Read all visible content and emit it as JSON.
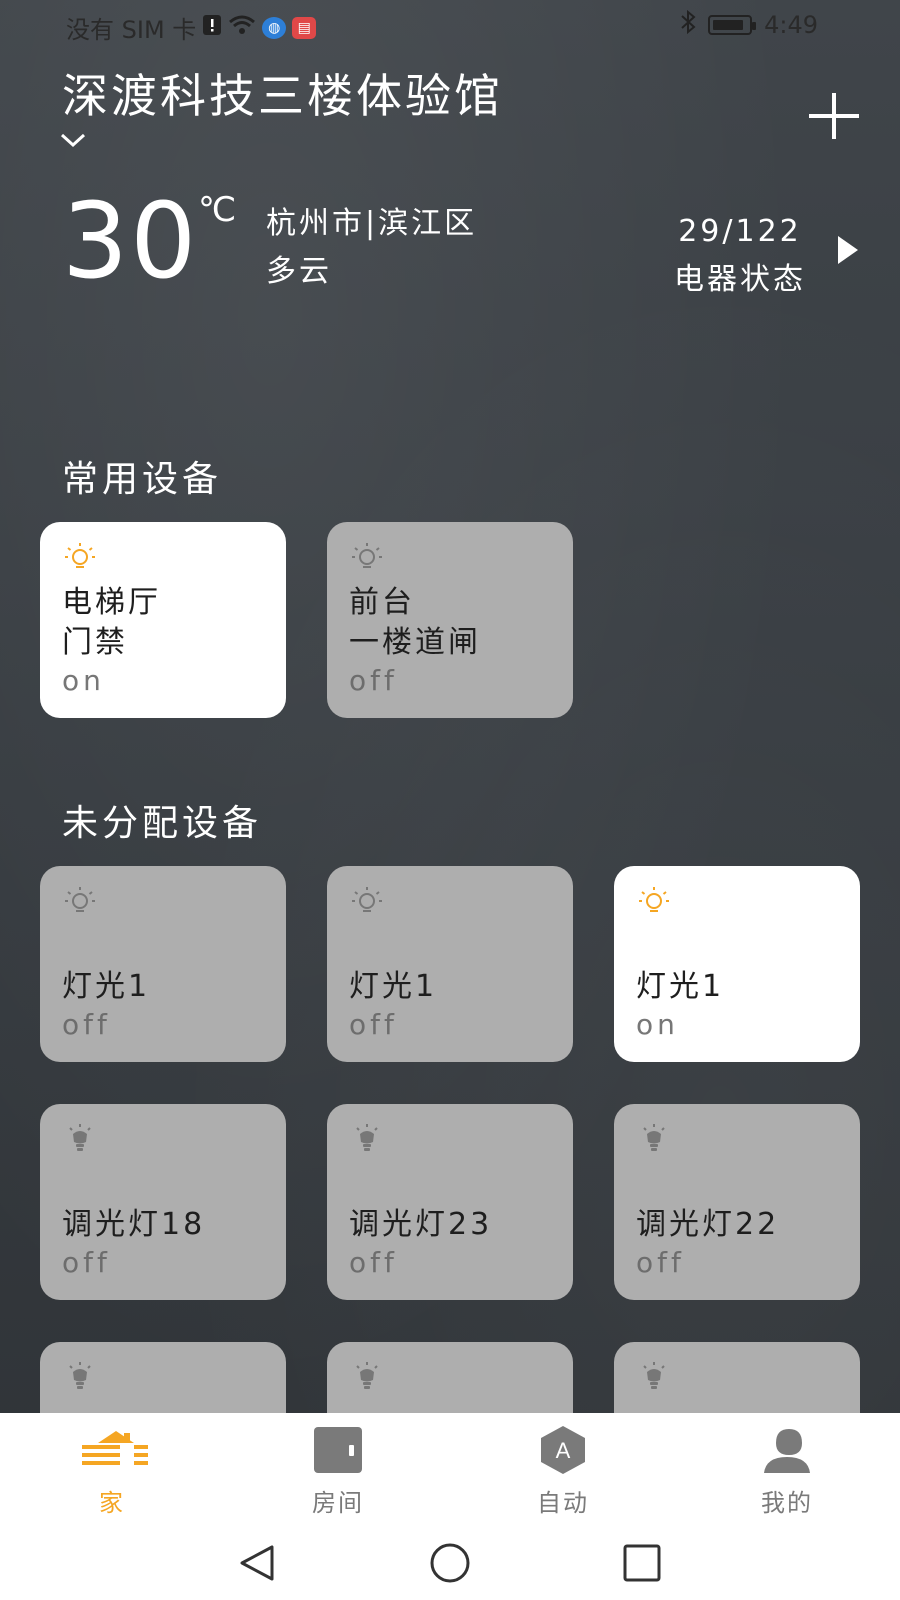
{
  "status_bar": {
    "carrier": "没有 SIM 卡",
    "time": "4:49"
  },
  "header": {
    "home_name": "深渡科技三楼体验馆"
  },
  "weather": {
    "temperature": "30",
    "unit": "℃",
    "location": "杭州市|滨江区",
    "condition": "多云"
  },
  "device_summary": {
    "count": "29/122",
    "label": "电器状态"
  },
  "favorites": {
    "title": "常用设备",
    "cards": [
      {
        "name1": "电梯厅",
        "name2": "门禁",
        "state": "on"
      },
      {
        "name1": "前台",
        "name2": "一楼道闸",
        "state": "off"
      }
    ]
  },
  "unassigned": {
    "title": "未分配设备",
    "cards": [
      {
        "name": "灯光1",
        "state": "off"
      },
      {
        "name": "灯光1",
        "state": "off"
      },
      {
        "name": "灯光1",
        "state": "on"
      },
      {
        "name": "调光灯18",
        "state": "off"
      },
      {
        "name": "调光灯23",
        "state": "off"
      },
      {
        "name": "调光灯22",
        "state": "off"
      }
    ]
  },
  "bottom_nav": {
    "items": [
      {
        "label": "家",
        "icon": "home-icon",
        "active": true
      },
      {
        "label": "房间",
        "icon": "door-icon",
        "active": false
      },
      {
        "label": "自动",
        "icon": "automation-icon",
        "active": false
      },
      {
        "label": "我的",
        "icon": "profile-icon",
        "active": false
      }
    ]
  },
  "colors": {
    "accent": "#f5a623",
    "card_off": "#aeaeae",
    "card_on": "#ffffff"
  }
}
